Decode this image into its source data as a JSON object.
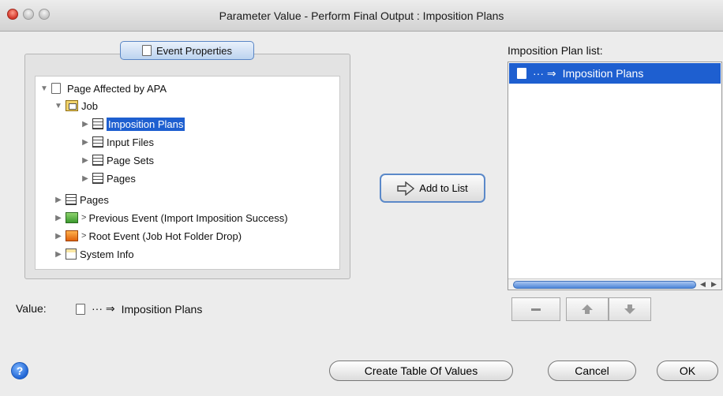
{
  "window": {
    "title": "Parameter Value - Perform Final Output : Imposition Plans"
  },
  "event_properties": {
    "tab_label": "Event Properties",
    "tree": [
      {
        "label": "Page Affected by APA",
        "icon": "page-icon",
        "expanded": true
      },
      {
        "label": "Job",
        "icon": "job-icon",
        "expanded": true
      },
      {
        "label": "Imposition Plans",
        "icon": "table-icon",
        "selected": true
      },
      {
        "label": "Input Files",
        "icon": "table-icon"
      },
      {
        "label": "Page Sets",
        "icon": "table-icon"
      },
      {
        "label": "Pages",
        "icon": "table-icon"
      },
      {
        "label": "Pages",
        "icon": "table-icon"
      },
      {
        "label": "Previous Event (Import Imposition Success)",
        "icon": "event-success-icon"
      },
      {
        "label": "Root Event (Job Hot Folder Drop)",
        "icon": "event-drop-icon"
      },
      {
        "label": "System Info",
        "icon": "system-info-icon"
      }
    ]
  },
  "add_to_list": {
    "label": "Add to List"
  },
  "imposition_list": {
    "label": "Imposition Plan list:",
    "items": [
      {
        "prefix": "··· ⇒",
        "label": "Imposition Plans"
      }
    ]
  },
  "value": {
    "label": "Value:",
    "prefix": "··· ⇒",
    "text": "Imposition Plans"
  },
  "footer": {
    "help_label": "?",
    "create_table_label": "Create Table Of Values",
    "cancel_label": "Cancel",
    "ok_label": "OK"
  },
  "colors": {
    "selection": "#1e5fd0",
    "focus_ring": "#5b89c9"
  }
}
